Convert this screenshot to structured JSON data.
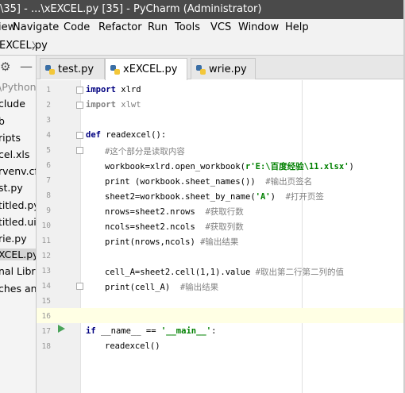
{
  "window": {
    "title": "\\35] - ...\\xEXCEL.py [35] - PyCharm (Administrator)"
  },
  "menu": {
    "items": [
      "iew",
      "Navigate",
      "Code",
      "Refactor",
      "Run",
      "Tools",
      "VCS",
      "Window",
      "Help"
    ]
  },
  "nav": {
    "crumb": "EXCEL.py",
    "chev": "〉"
  },
  "sidebar": {
    "items": [
      "\\PythonW",
      "clude",
      "b",
      "ripts",
      "cel.xls",
      "rvenv.cfg",
      "st.py",
      "titled.py",
      "titled.ui",
      "rie.py",
      "XCEL.py",
      "nal Libra",
      "ches and"
    ]
  },
  "tabs": [
    {
      "label": "test.py"
    },
    {
      "label": "xEXCEL.py"
    },
    {
      "label": "wrie.py"
    }
  ],
  "editor": {
    "line_numbers": [
      "1",
      "2",
      "3",
      "4",
      "5",
      "6",
      "7",
      "8",
      "9",
      "10",
      "11",
      "12",
      "13",
      "14",
      "15",
      "16",
      "17",
      "18"
    ],
    "lines": {
      "l1_kw": "import",
      "l1_rest": " xlrd",
      "l2_kw": "import",
      "l2_rest": " xlwt",
      "l4_kw": "def",
      "l4_rest": " readexcel():",
      "l5": "#这个部分是读取内容",
      "l6_a": "workbook=xlrd.open_workbook(",
      "l6_str": "r'E:\\百度经验\\11.xlsx'",
      "l6_b": ")",
      "l7_a": "print (workbook.sheet_names())  ",
      "l7_cm": "#输出页签名",
      "l8_a": "sheet2=workbook.sheet_by_name(",
      "l8_str": "'A'",
      "l8_b": ")  ",
      "l8_cm": "#打开页签",
      "l9_a": "nrows=sheet2.nrows  ",
      "l9_cm": "#获取行数",
      "l10_a": "ncols=sheet2.ncols  ",
      "l10_cm": "#获取列数",
      "l11_a": "print(nrows,ncols) ",
      "l11_cm": "#输出结果",
      "l13_a": "cell_A=sheet2.cell(1,1).value ",
      "l13_cm": "#取出第二行第二列的值",
      "l14_a": "print(cell_A)  ",
      "l14_cm": "#输出结果",
      "l17_kw": "if",
      "l17_a": " __name__ == ",
      "l17_str": "'__main__'",
      "l17_b": ":",
      "l18": "readexcel()"
    }
  },
  "colors": {
    "keyword": "#000080",
    "string": "#008000",
    "comment": "#808080",
    "run_icon": "#4aa35a"
  }
}
